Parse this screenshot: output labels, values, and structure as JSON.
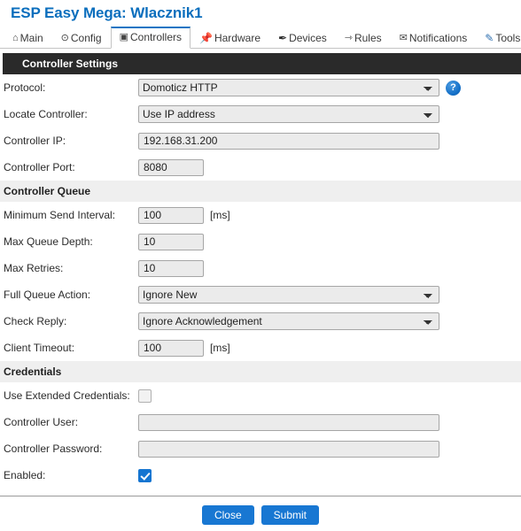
{
  "header": {
    "title": "ESP Easy Mega: Wlacznik1"
  },
  "tabs": [
    {
      "label": "Main",
      "icon": "home-icon",
      "glyph": "⌂",
      "active": false
    },
    {
      "label": "Config",
      "icon": "gear-icon",
      "glyph": "⊙",
      "active": false
    },
    {
      "label": "Controllers",
      "icon": "speech-bubble-icon",
      "glyph": "▣",
      "active": true
    },
    {
      "label": "Hardware",
      "icon": "pushpin-icon",
      "glyph": "📌",
      "active": false
    },
    {
      "label": "Devices",
      "icon": "plug-icon",
      "glyph": "✒",
      "active": false
    },
    {
      "label": "Rules",
      "icon": "arrow-icon",
      "glyph": "⇾",
      "active": false
    },
    {
      "label": "Notifications",
      "icon": "envelope-icon",
      "glyph": "✉",
      "active": false
    },
    {
      "label": "Tools",
      "icon": "pencil-icon",
      "glyph": "✎",
      "active": false
    }
  ],
  "sections": {
    "controller_settings": "Controller Settings",
    "controller_queue": "Controller Queue",
    "credentials": "Credentials"
  },
  "fields": {
    "protocol": {
      "label": "Protocol:",
      "value": "Domoticz HTTP",
      "options": [
        "Domoticz HTTP"
      ]
    },
    "locate_controller": {
      "label": "Locate Controller:",
      "value": "Use IP address",
      "options": [
        "Use IP address"
      ]
    },
    "controller_ip": {
      "label": "Controller IP:",
      "value": "192.168.31.200",
      "placeholder": ""
    },
    "controller_port": {
      "label": "Controller Port:",
      "value": "8080",
      "placeholder": ""
    },
    "minimum_send_interval": {
      "label": "Minimum Send Interval:",
      "value": "100",
      "unit": "[ms]"
    },
    "max_queue_depth": {
      "label": "Max Queue Depth:",
      "value": "10"
    },
    "max_retries": {
      "label": "Max Retries:",
      "value": "10"
    },
    "full_queue_action": {
      "label": "Full Queue Action:",
      "value": "Ignore New",
      "options": [
        "Ignore New"
      ]
    },
    "check_reply": {
      "label": "Check Reply:",
      "value": "Ignore Acknowledgement",
      "options": [
        "Ignore Acknowledgement"
      ]
    },
    "client_timeout": {
      "label": "Client Timeout:",
      "value": "100",
      "unit": "[ms]"
    },
    "use_extended_credentials": {
      "label": "Use Extended Credentials:",
      "checked": false
    },
    "controller_user": {
      "label": "Controller User:",
      "value": "",
      "placeholder": ""
    },
    "controller_password": {
      "label": "Controller Password:",
      "value": "",
      "placeholder": ""
    },
    "enabled": {
      "label": "Enabled:",
      "checked": true
    }
  },
  "help": {
    "glyph": "?"
  },
  "footer": {
    "close_label": "Close",
    "submit_label": "Submit"
  },
  "colors": {
    "accent": "#1877d2",
    "title": "#0a6ebd",
    "active_tab_border": "#1675c4",
    "dark_header_bg": "#2a2a2a",
    "light_header_bg": "#efefef",
    "input_bg": "#ebebeb"
  }
}
